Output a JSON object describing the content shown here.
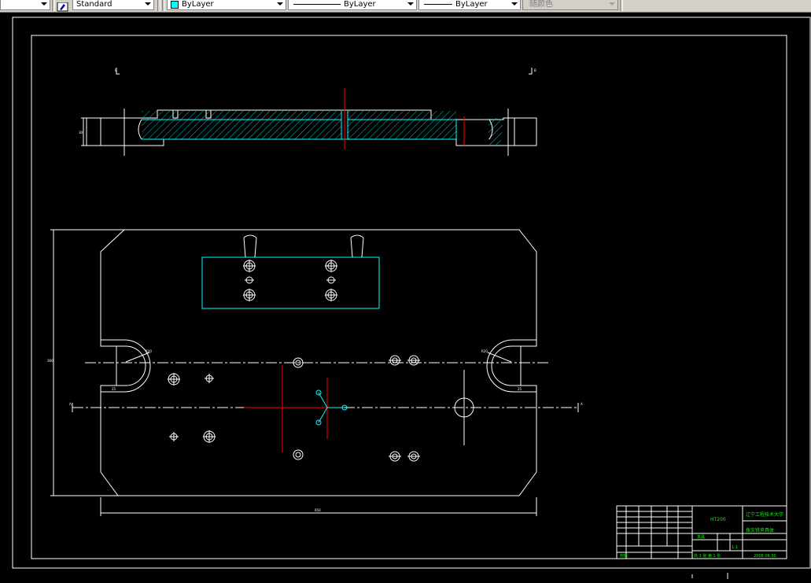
{
  "toolbar": {
    "text_style": "Standard",
    "layer": "ByLayer",
    "linetype": "ByLayer",
    "lineweight": "ByLayer",
    "color": "随颜色"
  },
  "drawing": {
    "section_mark_left": "B",
    "section_mark_right": "B",
    "axis_mark_left": "A",
    "axis_mark_right": "A",
    "dim_height": "30",
    "dim_width_top": "650",
    "dim_overall_height": "360",
    "dim_slot_left": "R20",
    "dim_slot_right": "R20",
    "dim_small_left": "25",
    "dim_small_right": "25"
  },
  "title_block": {
    "university": "辽宁工程技术大学",
    "drawing_name": "夹具",
    "product_name": "拨叉铣夹具体",
    "drawing_no": "HT200",
    "scale": "1:1",
    "sheet": "共 1 张  第 1 张",
    "material_row": "材料",
    "date_code": "2008.06.30"
  }
}
